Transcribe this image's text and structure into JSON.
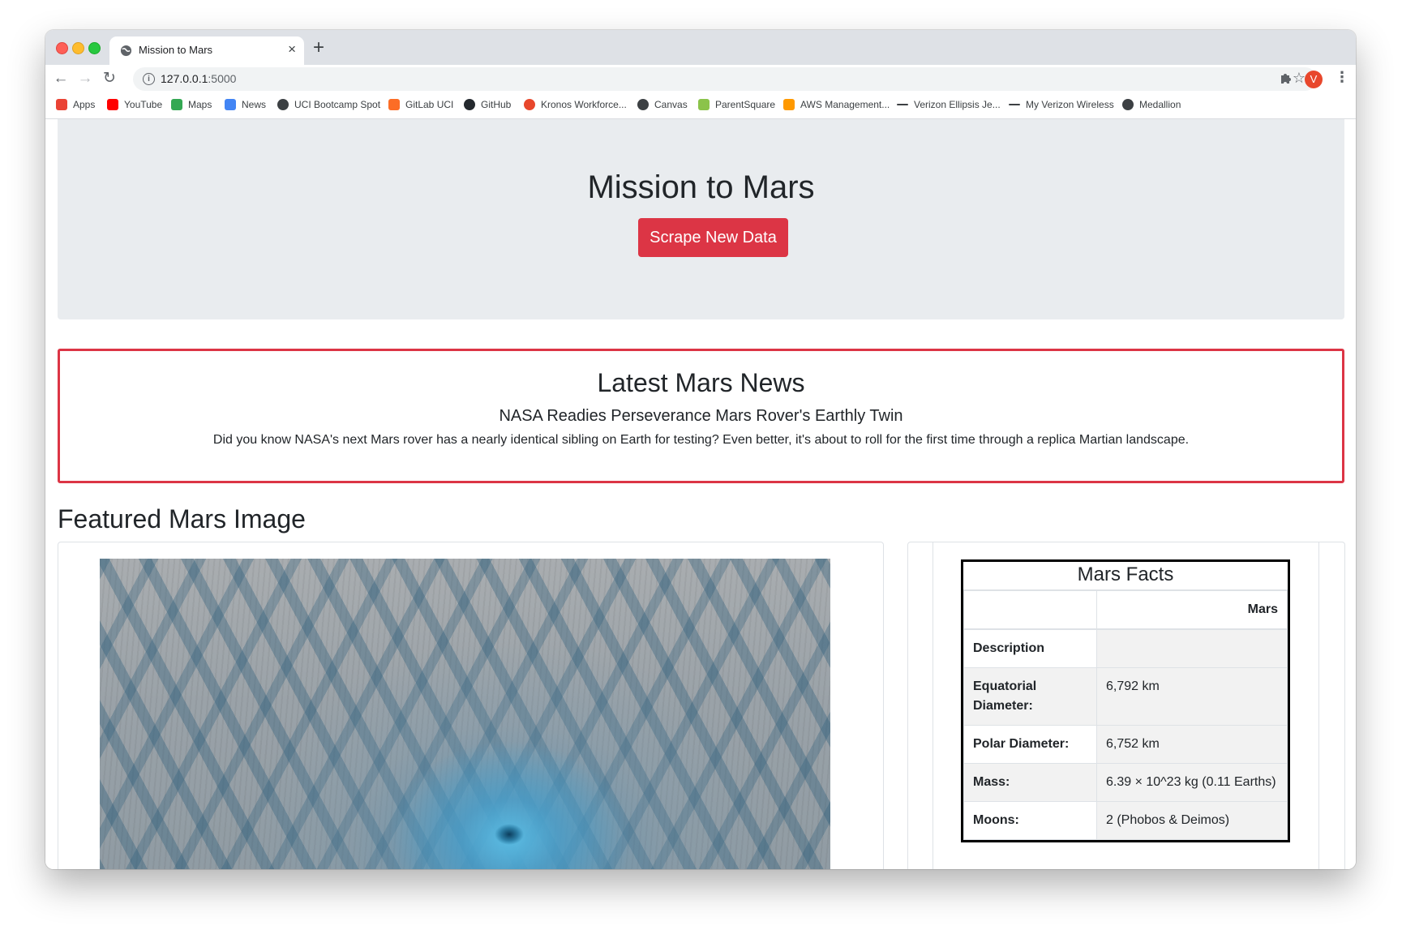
{
  "browser": {
    "tab_title": "Mission to Mars",
    "tab_close": "×",
    "new_tab": "+",
    "url_host": "127.0.0.1",
    "url_port": ":5000",
    "avatar_letter": "V",
    "nav": {
      "back": "←",
      "forward": "→",
      "reload": "↻"
    },
    "star": "☆",
    "menu": "⋮",
    "bookmarks": [
      {
        "label": "Apps",
        "icon": "apps-grid-icon",
        "color": "#ea4335"
      },
      {
        "label": "YouTube",
        "icon": "youtube-icon",
        "color": "#ff0000"
      },
      {
        "label": "Maps",
        "icon": "maps-pin-icon",
        "color": "#34a853"
      },
      {
        "label": "News",
        "icon": "news-icon",
        "color": "#4285f4"
      },
      {
        "label": "UCI Bootcamp Spot",
        "icon": "globe-icon",
        "color": "#3c4043"
      },
      {
        "label": "GitLab UCI",
        "icon": "gitlab-icon",
        "color": "#fc6d26"
      },
      {
        "label": "GitHub",
        "icon": "github-icon",
        "color": "#24292e"
      },
      {
        "label": "Kronos Workforce...",
        "icon": "kronos-icon",
        "color": "#e8472c"
      },
      {
        "label": "Canvas",
        "icon": "globe-icon",
        "color": "#3c4043"
      },
      {
        "label": "ParentSquare",
        "icon": "parentsquare-icon",
        "color": "#8bc34a"
      },
      {
        "label": "AWS Management...",
        "icon": "aws-icon",
        "color": "#ff9900"
      },
      {
        "label": "Verizon Ellipsis Je...",
        "icon": "dash-icon",
        "color": "#3c4043"
      },
      {
        "label": "My Verizon Wireless",
        "icon": "dash-icon",
        "color": "#3c4043"
      },
      {
        "label": "Medallion",
        "icon": "globe-icon",
        "color": "#3c4043"
      }
    ]
  },
  "jumbotron": {
    "title": "Mission to Mars",
    "button_label": "Scrape New Data",
    "button_color": "#dc3545"
  },
  "news": {
    "heading": "Latest Mars News",
    "title": "NASA Readies Perseverance Mars Rover's Earthly Twin",
    "paragraph": "Did you know NASA's next Mars rover has a nearly identical sibling on Earth for testing? Even better, it's about to roll for the first time through a replica Martian landscape.",
    "border_color": "#dc3545"
  },
  "featured": {
    "heading": "Featured Mars Image"
  },
  "facts": {
    "caption": "Mars Facts",
    "column_header": "Mars",
    "rows": [
      {
        "label": "Description",
        "value": ""
      },
      {
        "label": "Equatorial Diameter:",
        "value": "6,792 km"
      },
      {
        "label": "Polar Diameter:",
        "value": "6,752 km"
      },
      {
        "label": "Mass:",
        "value": "6.39 × 10^23 kg (0.11 Earths)"
      },
      {
        "label": "Moons:",
        "value": "2 (Phobos & Deimos)"
      }
    ]
  }
}
